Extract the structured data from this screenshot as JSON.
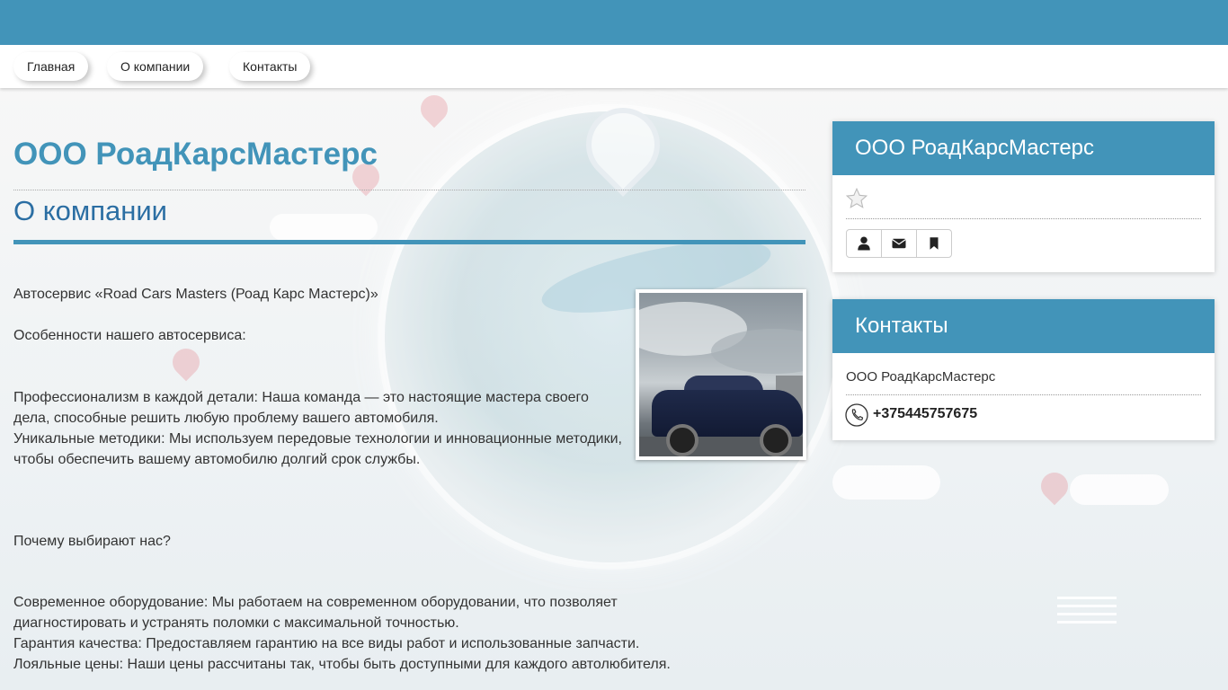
{
  "nav": {
    "items": [
      {
        "label": "Главная"
      },
      {
        "label": "О компании"
      },
      {
        "label": "Контакты"
      }
    ]
  },
  "main": {
    "title": "ООО РоадКарсМастерс",
    "section_title": "О компании",
    "paragraphs": [
      "Автосервис «Road Cars Masters (Роад Карс Мастерс)»",
      "Особенности нашего автосервиса:",
      "Профессионализм в каждой детали: Наша команда — это настоящие мастера своего дела, способные решить любую проблему вашего автомобиля.",
      "Уникальные методики: Мы используем передовые технологии и инновационные методики, чтобы обеспечить вашему автомобилю долгий срок службы.",
      "Почему выбирают нас?",
      "Современное оборудование: Мы работаем на современном оборудовании, что позволяет диагностировать и устранять поломки с максимальной точностью.",
      "Гарантия качества: Предоставляем гарантию на все виды работ и использованные запчасти.",
      "Лояльные цены: Наши цены рассчитаны так, чтобы быть доступными для каждого автолюбителя."
    ]
  },
  "sidebar": {
    "company_card": {
      "title": "ООО РоадКарсМастерс",
      "icons": [
        "star-icon",
        "user-icon",
        "envelope-icon",
        "bookmark-icon"
      ]
    },
    "contacts_card": {
      "title": "Контакты",
      "company": "ООО РоадКарсМастерс",
      "phone": "+375445757675",
      "icons": [
        "phone-icon"
      ]
    }
  },
  "colors": {
    "primary": "#4294b9",
    "section_title": "#2b6ea3",
    "text": "#333333"
  }
}
